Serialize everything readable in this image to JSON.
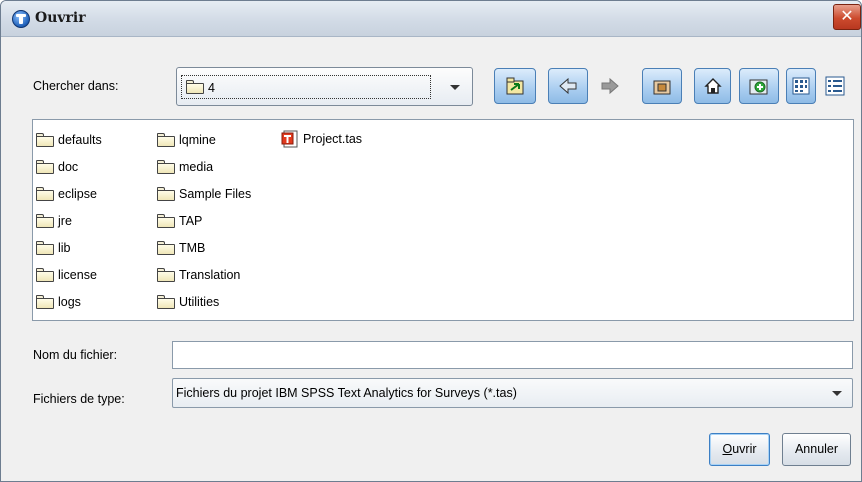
{
  "window": {
    "title": "Ouvrir",
    "close_glyph": "✕"
  },
  "look_in": {
    "label": "Chercher dans:",
    "value": "4"
  },
  "toolbar": {
    "buttons": [
      {
        "name": "recent-places-icon"
      },
      {
        "name": "back-icon"
      },
      {
        "name": "forward-icon"
      },
      {
        "name": "up-folder-icon"
      },
      {
        "name": "home-icon"
      },
      {
        "name": "new-folder-icon"
      },
      {
        "name": "list-view-icon"
      },
      {
        "name": "details-view-icon"
      }
    ]
  },
  "files": {
    "col1": [
      "defaults",
      "doc",
      "eclipse",
      "jre",
      "lib",
      "license",
      "logs"
    ],
    "col2": [
      "lqmine",
      "media",
      "Sample Files",
      "TAP",
      "TMB",
      "Translation",
      "Utilities"
    ],
    "col3": [
      "Project.tas"
    ]
  },
  "file_name": {
    "label": "Nom du fichier:",
    "value": ""
  },
  "file_type": {
    "label": "Fichiers de type:",
    "value": "Fichiers du projet IBM SPSS Text Analytics for Surveys (*.tas)"
  },
  "buttons": {
    "open": "Ouvrir",
    "cancel": "Annuler"
  }
}
